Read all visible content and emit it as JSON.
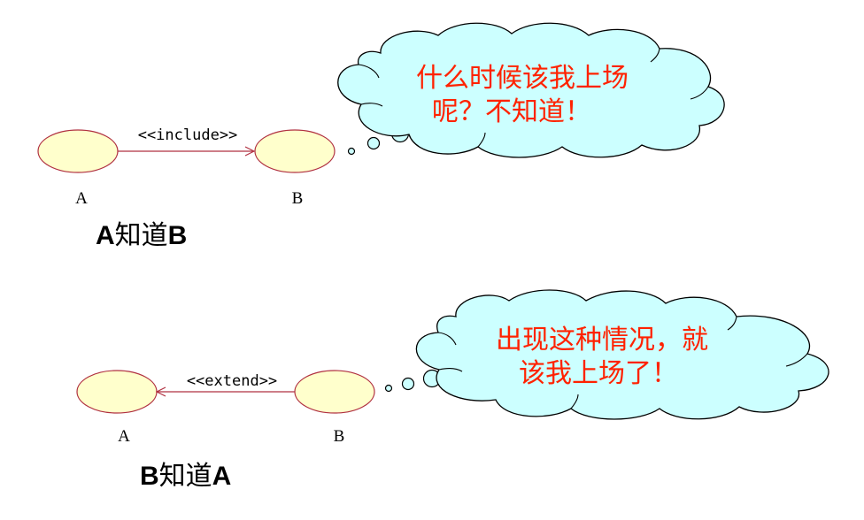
{
  "colors": {
    "ellipse_fill": "#ffffcc",
    "ellipse_stroke": "#b03040",
    "cloud_fill": "#ccffff",
    "cloud_stroke": "#000000",
    "cloud_text": "#ff2200",
    "relation_line": "#b03040"
  },
  "top": {
    "stereotype": "<<include>>",
    "left_label": "A",
    "right_label": "B",
    "caption_a": "A",
    "caption_mid": "知道",
    "caption_b": "B",
    "cloud_line1": "什么时候该我上场",
    "cloud_line2": "呢？不知道！"
  },
  "bottom": {
    "stereotype": "<<extend>>",
    "left_label": "A",
    "right_label": "B",
    "caption_a": "B",
    "caption_mid": "知道",
    "caption_b": "A",
    "cloud_line1": "出现这种情况，就",
    "cloud_line2": "该我上场了！"
  }
}
